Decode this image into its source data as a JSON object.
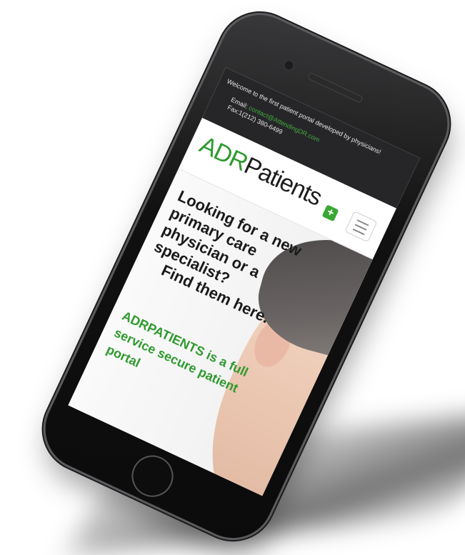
{
  "topbar": {
    "welcome": "Welcome to the first patient portal developed by physicians!",
    "email_label": "Email:",
    "email_value": "contact@AttendingDR.com",
    "fax": "Fax:1(212) 380-6499"
  },
  "header": {
    "logo_adr": "ADR",
    "logo_patients": "Patients",
    "plus_symbol": "+",
    "brand_color": "#2e9a2e"
  },
  "hero": {
    "headline_lines": "Looking for a new primary care physician or a specialist?",
    "headline_find": "Find them here.",
    "tagline": "ADRPATIENTS is a full service secure patient portal"
  },
  "icons": {
    "plus": "plus-icon",
    "menu": "hamburger-menu-icon"
  }
}
